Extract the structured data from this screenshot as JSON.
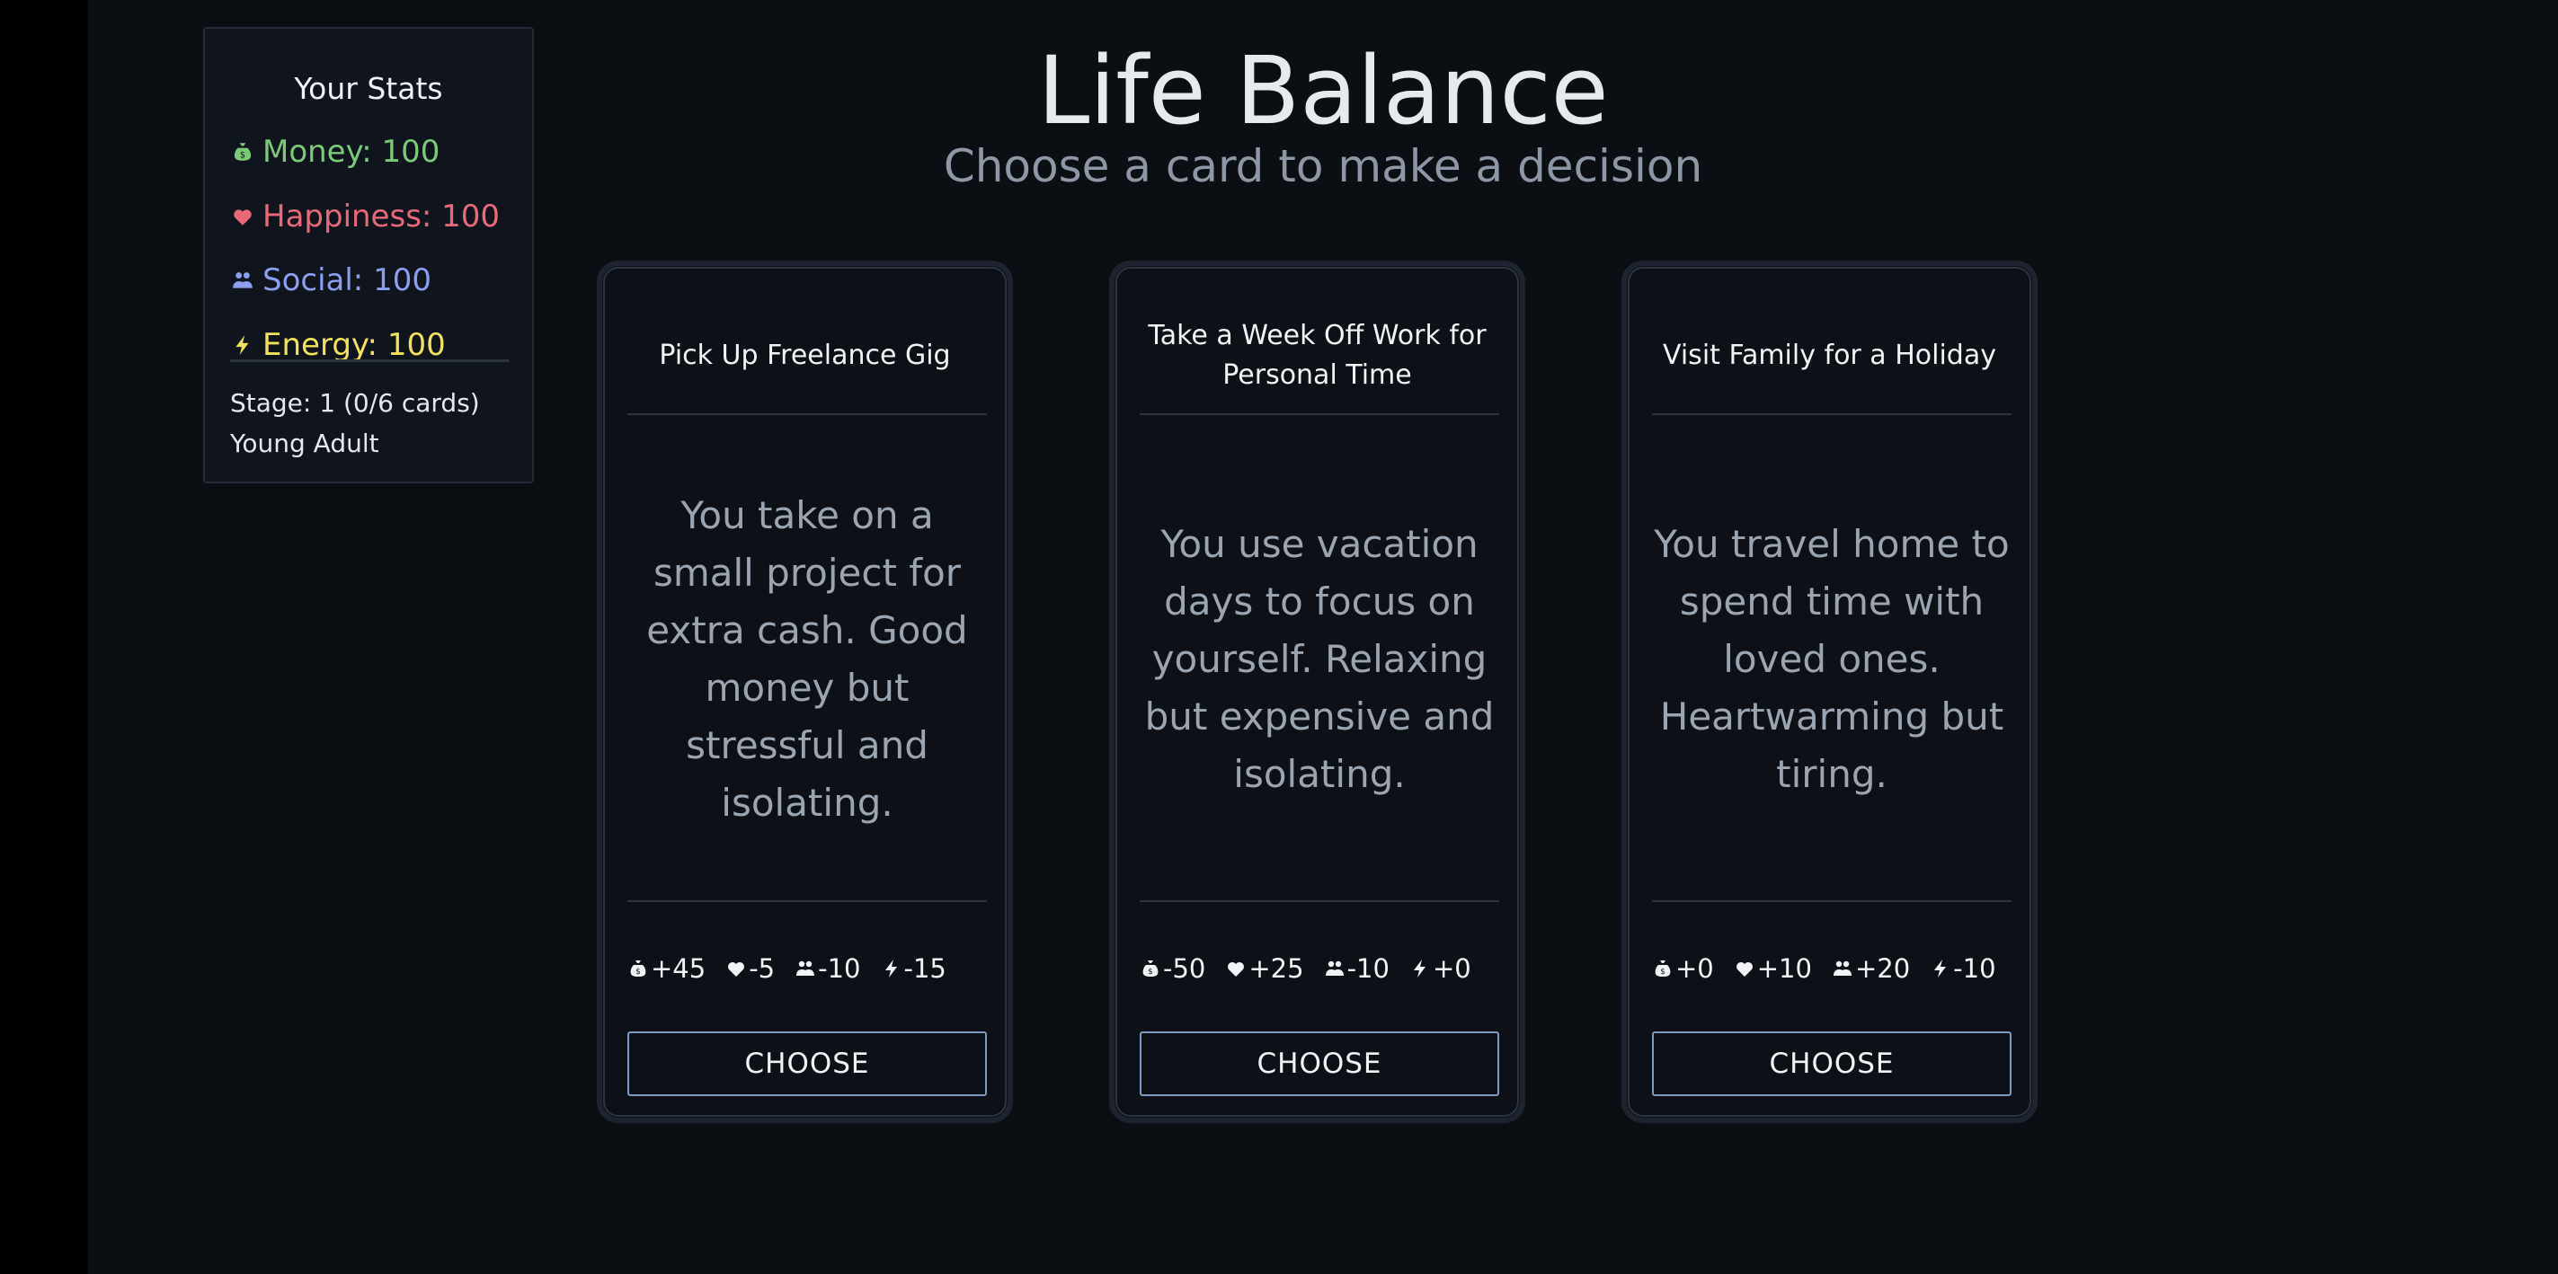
{
  "header": {
    "title": "Life Balance",
    "subtitle": "Choose a card to make a decision"
  },
  "stats": {
    "title": "Your Stats",
    "items": [
      {
        "icon": "money-bag-icon",
        "label": "Money: 100",
        "color": "#7cc97a"
      },
      {
        "icon": "heart-icon",
        "label": "Happiness: 100",
        "color": "#e8697a"
      },
      {
        "icon": "people-icon",
        "label": "Social: 100",
        "color": "#8c9ef0"
      },
      {
        "icon": "lightning-icon",
        "label": "Energy: 100",
        "color": "#f2e25a"
      }
    ],
    "stage": "Stage: 1 (0/6 cards)",
    "stage_name": "Young Adult"
  },
  "cards": [
    {
      "title": "Pick Up Freelance Gig",
      "description": "You take on a small project for extra cash. Good money but stressful and isolating.",
      "effects": {
        "money": "+45",
        "happiness": "-5",
        "social": "-10",
        "energy": "-15"
      },
      "button": "CHOOSE"
    },
    {
      "title": "Take a Week Off Work for Personal Time",
      "description": "You use vacation days to focus on yourself. Relaxing but expensive and isolating.",
      "effects": {
        "money": "-50",
        "happiness": "+25",
        "social": "-10",
        "energy": "+0"
      },
      "button": "CHOOSE"
    },
    {
      "title": "Visit Family for a Holiday",
      "description": "You travel home to spend time with loved ones. Heartwarming but tiring.",
      "effects": {
        "money": "+0",
        "happiness": "+10",
        "social": "+20",
        "energy": "-10"
      },
      "button": "CHOOSE"
    }
  ]
}
